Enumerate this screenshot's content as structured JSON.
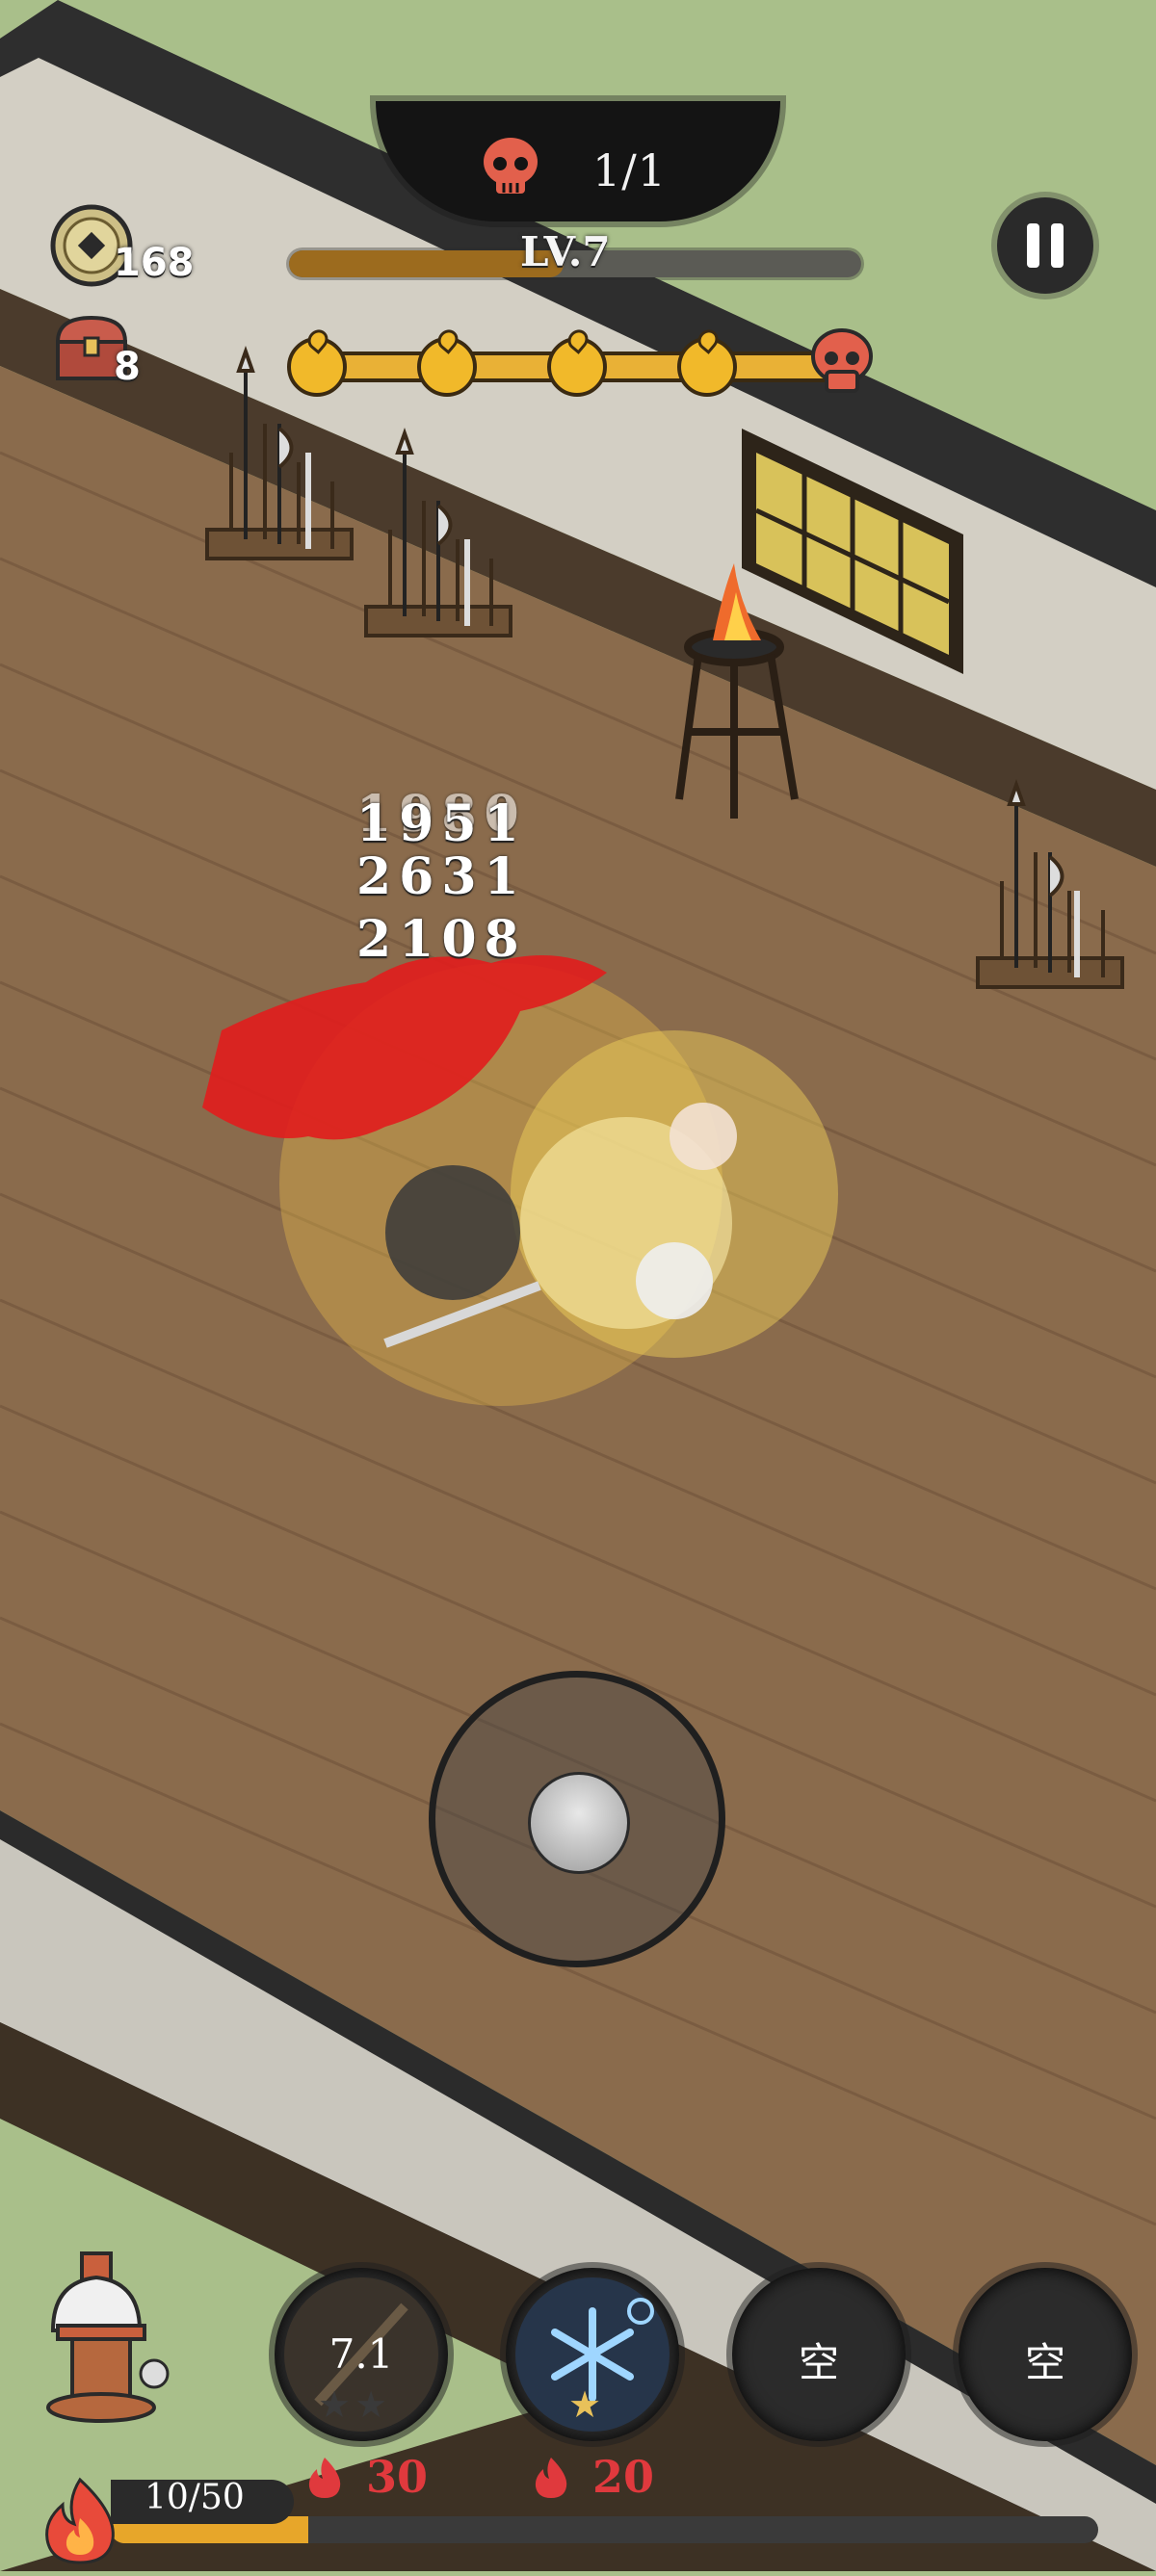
{
  "hud": {
    "boss_counter": "1/1",
    "level_label": "LV.7",
    "level_progress": 0.48,
    "coins": "168",
    "chests": "8",
    "wave_nodes": 4,
    "wave_progress": 1.0,
    "pause_icon": "pause-icon"
  },
  "combat": {
    "damage_numbers": [
      "1951",
      "2631",
      "2108"
    ],
    "faded_number": "1980"
  },
  "skills": {
    "slot1": {
      "cooldown": "7.1",
      "cost": "30",
      "stars": "★★"
    },
    "slot2": {
      "cost": "20",
      "stars": "★",
      "icon": "snowflake-icon"
    },
    "slot3": {
      "label": "空"
    },
    "slot4": {
      "label": "空"
    }
  },
  "exp": {
    "text": "10/50",
    "progress": 0.2
  },
  "colors": {
    "wood_floor": "#8a6b4c",
    "wall": "#c9c6bd",
    "grass": "#a9bf8a",
    "gold": "#e9b136",
    "skull_red": "#e2604c",
    "cost_red": "#e0393d"
  }
}
